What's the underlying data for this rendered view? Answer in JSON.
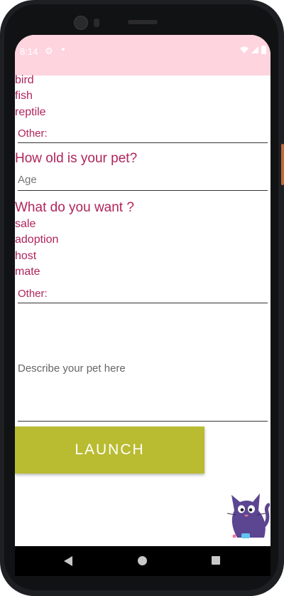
{
  "status_bar": {
    "time": "8:14",
    "bg_color": "#fed4de"
  },
  "pet_type_options_visible": [
    "bird",
    "fish",
    "reptile"
  ],
  "pet_type_other_label": "Other:",
  "age_question": "How old is your pet?",
  "age_input": {
    "placeholder": "Age",
    "value": ""
  },
  "want_question": "What do you want ?",
  "want_options": [
    "sale",
    "adoption",
    "host",
    "mate"
  ],
  "want_other_label": "Other:",
  "description_input": {
    "placeholder": "Describe your pet here",
    "value": ""
  },
  "launch_button": {
    "label": "LAUNCH",
    "color": "#b9bb31"
  },
  "accent_text_color": "#b0245a",
  "mascot_icon": "cat-mascot-icon"
}
